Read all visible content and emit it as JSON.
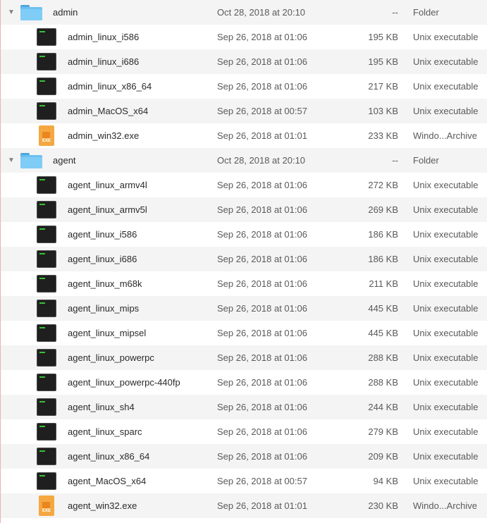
{
  "rows": [
    {
      "type": "folder",
      "name": "admin",
      "date": "Oct 28, 2018 at 20:10",
      "size": "--",
      "kind": "Folder"
    },
    {
      "type": "exec",
      "name": "admin_linux_i586",
      "date": "Sep 26, 2018 at 01:06",
      "size": "195 KB",
      "kind": "Unix executable"
    },
    {
      "type": "exec",
      "name": "admin_linux_i686",
      "date": "Sep 26, 2018 at 01:06",
      "size": "195 KB",
      "kind": "Unix executable"
    },
    {
      "type": "exec",
      "name": "admin_linux_x86_64",
      "date": "Sep 26, 2018 at 01:06",
      "size": "217 KB",
      "kind": "Unix executable"
    },
    {
      "type": "exec",
      "name": "admin_MacOS_x64",
      "date": "Sep 26, 2018 at 00:57",
      "size": "103 KB",
      "kind": "Unix executable"
    },
    {
      "type": "exe",
      "name": "admin_win32.exe",
      "date": "Sep 26, 2018 at 01:01",
      "size": "233 KB",
      "kind": "Windo...Archive"
    },
    {
      "type": "folder",
      "name": "agent",
      "date": "Oct 28, 2018 at 20:10",
      "size": "--",
      "kind": "Folder"
    },
    {
      "type": "exec",
      "name": "agent_linux_armv4l",
      "date": "Sep 26, 2018 at 01:06",
      "size": "272 KB",
      "kind": "Unix executable"
    },
    {
      "type": "exec",
      "name": "agent_linux_armv5l",
      "date": "Sep 26, 2018 at 01:06",
      "size": "269 KB",
      "kind": "Unix executable"
    },
    {
      "type": "exec",
      "name": "agent_linux_i586",
      "date": "Sep 26, 2018 at 01:06",
      "size": "186 KB",
      "kind": "Unix executable"
    },
    {
      "type": "exec",
      "name": "agent_linux_i686",
      "date": "Sep 26, 2018 at 01:06",
      "size": "186 KB",
      "kind": "Unix executable"
    },
    {
      "type": "exec",
      "name": "agent_linux_m68k",
      "date": "Sep 26, 2018 at 01:06",
      "size": "211 KB",
      "kind": "Unix executable"
    },
    {
      "type": "exec",
      "name": "agent_linux_mips",
      "date": "Sep 26, 2018 at 01:06",
      "size": "445 KB",
      "kind": "Unix executable"
    },
    {
      "type": "exec",
      "name": "agent_linux_mipsel",
      "date": "Sep 26, 2018 at 01:06",
      "size": "445 KB",
      "kind": "Unix executable"
    },
    {
      "type": "exec",
      "name": "agent_linux_powerpc",
      "date": "Sep 26, 2018 at 01:06",
      "size": "288 KB",
      "kind": "Unix executable"
    },
    {
      "type": "exec",
      "name": "agent_linux_powerpc-440fp",
      "date": "Sep 26, 2018 at 01:06",
      "size": "288 KB",
      "kind": "Unix executable"
    },
    {
      "type": "exec",
      "name": "agent_linux_sh4",
      "date": "Sep 26, 2018 at 01:06",
      "size": "244 KB",
      "kind": "Unix executable"
    },
    {
      "type": "exec",
      "name": "agent_linux_sparc",
      "date": "Sep 26, 2018 at 01:06",
      "size": "279 KB",
      "kind": "Unix executable"
    },
    {
      "type": "exec",
      "name": "agent_linux_x86_64",
      "date": "Sep 26, 2018 at 01:06",
      "size": "209 KB",
      "kind": "Unix executable"
    },
    {
      "type": "exec",
      "name": "agent_MacOS_x64",
      "date": "Sep 26, 2018 at 00:57",
      "size": "94 KB",
      "kind": "Unix executable"
    },
    {
      "type": "exe",
      "name": "agent_win32.exe",
      "date": "Sep 26, 2018 at 01:01",
      "size": "230 KB",
      "kind": "Windo...Archive"
    }
  ],
  "icons": {
    "disclosure": "▼",
    "exe_label": "EXE"
  },
  "colors": {
    "row_alt": "#f4f4f4",
    "folder": "#6cc0f0",
    "exe": "#f5a841",
    "terminal_prompt": "#37c137"
  }
}
